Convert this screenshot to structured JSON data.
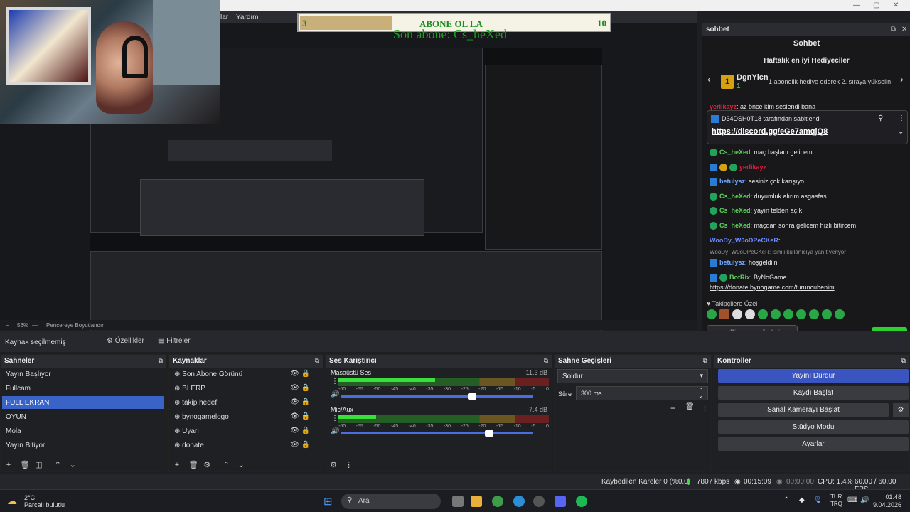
{
  "window": {
    "menu_item": "Yardım",
    "menu_partial": "lar"
  },
  "overlay": {
    "left_num": "3",
    "title": "ABONE OL LA",
    "right_num": "10",
    "subtitle": "Son abone: Cs_heXed"
  },
  "chat": {
    "dock_title": "sohbet",
    "header": "Sohbet",
    "gift_title": "Haftalık en iyi Hediyeciler",
    "gift_rank": "1",
    "gift_user": "DgnYlcn",
    "gift_count": "1",
    "gift_msg": "1 abonelik hediye ederek 2. sıraya yükselin",
    "pinned_by": "D34DSH0T18 tarafından sabitlendi",
    "pinned_link": "https://discord.gg/eGe7amqjQ8",
    "partial_msg": ": az önce kim seslendi bana",
    "messages": [
      {
        "user": "Cs_heXed",
        "text": ": maç başladı gelicem",
        "color": "#5ad35a"
      },
      {
        "user": "yerlikayz",
        "text": ":",
        "color": "#e0213f"
      },
      {
        "user": "betulysz",
        "text": ": sesiniz çok karışıyo..",
        "color": "#6fa8ff"
      },
      {
        "user": "Cs_heXed",
        "text": ": duyumluk alırım asgasfas",
        "color": "#5ad35a"
      },
      {
        "user": "Cs_heXed",
        "text": ": yayın telden açık",
        "color": "#5ad35a"
      },
      {
        "user": "Cs_heXed",
        "text": ": maçdan sonra gelicem hızlı bitircem",
        "color": "#5ad35a"
      },
      {
        "user": "WooDy_W0oDPeCKeR",
        "text": ":",
        "color": "#6f8cff"
      },
      {
        "user": "",
        "text": "WooDy_W0oDPeCKeR: isimli kullanıcıya yanıt veriyor",
        "color": "#999"
      },
      {
        "user": "betulysz",
        "text": ": hoşgeldiin",
        "color": "#6fa8ff"
      },
      {
        "user": "BotRix",
        "text": ": ByNoGame",
        "color": "#5ad35a"
      },
      {
        "user": "",
        "text": "https://donate.bynogame.com/turuncubenim",
        "color": "#ffffff"
      }
    ],
    "follow_label": "Takipçilere Özel",
    "input_placeholder": "Bir mesaj gönderin",
    "send_label": "Gönder"
  },
  "zoom": {
    "percent": "56%",
    "fit": "Pencereye Boyutlandır"
  },
  "propbar": {
    "selection": "Kaynak seçilmemiş",
    "properties": "Özellikler",
    "filters": "Filtreler"
  },
  "scenes": {
    "title": "Sahneler",
    "items": [
      "Yayın Başlıyor",
      "Fullcam",
      "FULL EKRAN",
      "OYUN",
      "Mola",
      "Yayın Bitiyor"
    ],
    "active": "FULL EKRAN"
  },
  "sources": {
    "title": "Kaynaklar",
    "items": [
      "Son Abone Görünü",
      "BLERP",
      "takip hedef",
      "bynogamelogo",
      "Uyarı",
      "donate"
    ]
  },
  "mixer": {
    "title": "Ses Karıştırıcı",
    "channels": [
      {
        "name": "Masaüstü Ses",
        "db": "-11.3 dB",
        "level": 0.46,
        "volume": 0.68
      },
      {
        "name": "Mic/Aux",
        "db": "-7.4 dB",
        "level": 0.18,
        "volume": 0.77
      }
    ],
    "scale": [
      "-60",
      "-55",
      "-50",
      "-45",
      "-40",
      "-35",
      "-30",
      "-25",
      "-20",
      "-15",
      "-10",
      "-5",
      "0"
    ]
  },
  "transitions": {
    "title": "Sahne Geçişleri",
    "type": "Soldur",
    "duration_label": "Süre",
    "duration": "300 ms"
  },
  "controls": {
    "title": "Kontroller",
    "buttons": [
      "Yayını Durdur",
      "Kaydı Başlat",
      "Sanal Kamerayı Başlat",
      "Stüdyo Modu",
      "Ayarlar"
    ]
  },
  "status": {
    "dropped": "Kaybedilen Kareler 0 (%0.0)",
    "bitrate": "7807 kbps",
    "live_time": "00:15:09",
    "rec_time": "00:00:00",
    "cpu": "CPU: 1.4%",
    "fps": "60.00 / 60.00 FPS"
  },
  "taskbar": {
    "temp": "2°C",
    "weather": "Parçalı bulutlu",
    "search": "Ara",
    "lang1": "TUR",
    "lang2": "TRQ",
    "time": "01:48",
    "date": "9.04.2026"
  },
  "colors": {
    "accent": "#3b55c0",
    "send": "#2fcf2f",
    "overlay_text": "#1b8a1b"
  }
}
